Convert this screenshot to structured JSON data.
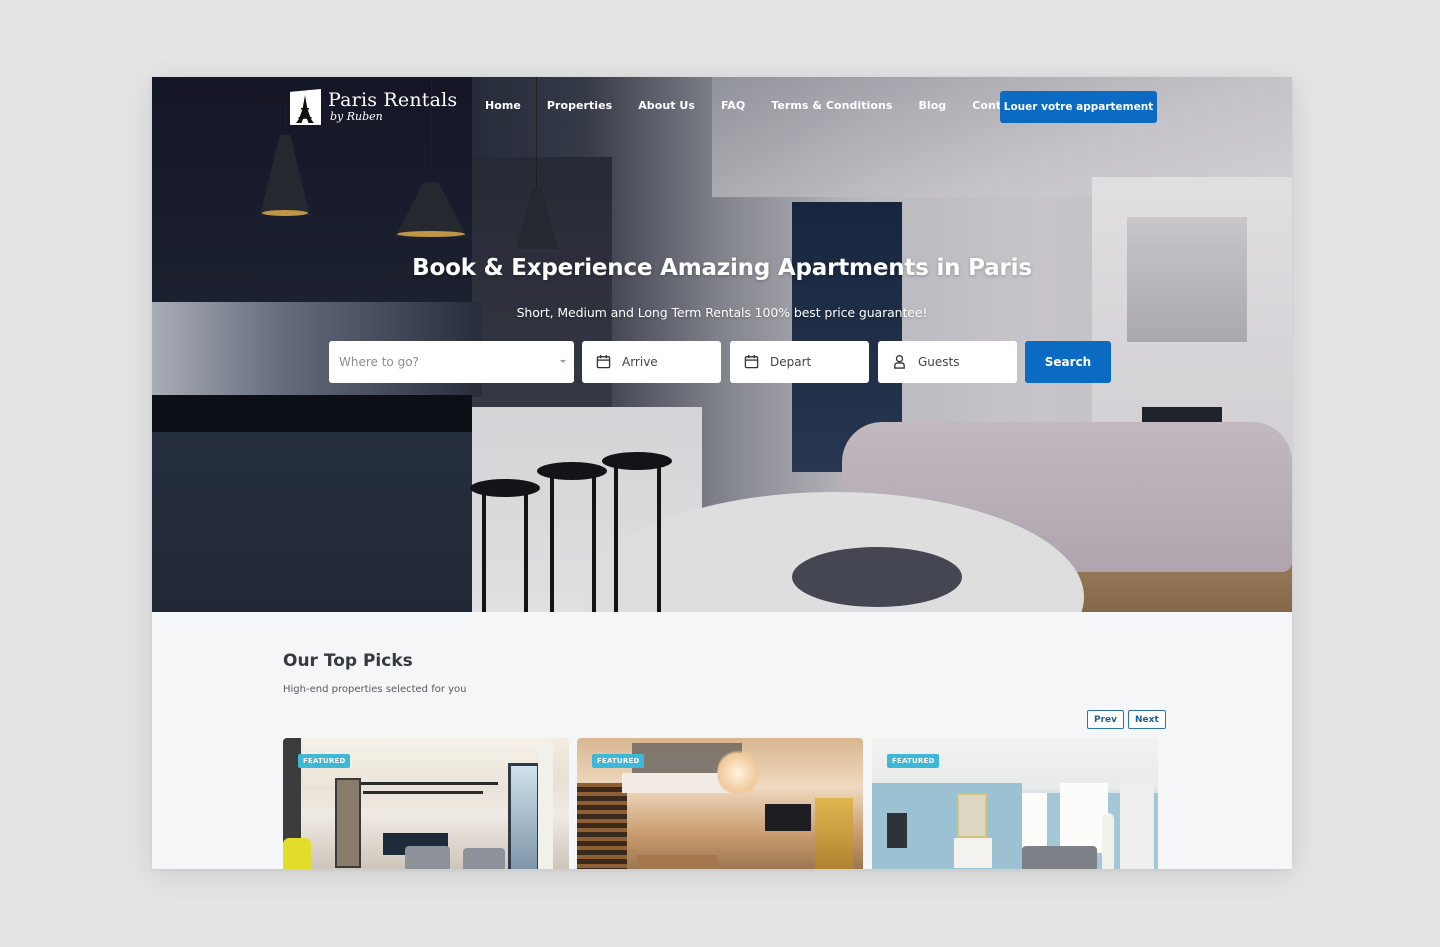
{
  "brand": {
    "title": "Paris Rentals",
    "subtitle": "by Ruben",
    "primary_color": "#0b6bc3",
    "badge_color": "#3fb7d6"
  },
  "nav": {
    "links": [
      {
        "label": "Home"
      },
      {
        "label": "Properties"
      },
      {
        "label": "About Us"
      },
      {
        "label": "FAQ"
      },
      {
        "label": "Terms & Conditions"
      },
      {
        "label": "Blog"
      },
      {
        "label": "Contact us"
      }
    ],
    "cta_label": "Louer votre appartement"
  },
  "hero": {
    "title": "Book & Experience Amazing Apartments in Paris",
    "subtitle": "Short, Medium and Long Term Rentals 100% best price guarantee!"
  },
  "search": {
    "where_placeholder": "Where to go?",
    "arrive_label": "Arrive",
    "depart_label": "Depart",
    "guests_label": "Guests",
    "button_label": "Search",
    "icons": {
      "arrive": "calendar-icon",
      "depart": "calendar-icon",
      "guests": "user-icon",
      "where": "chevron-down-icon"
    }
  },
  "top_picks": {
    "title": "Our Top Picks",
    "subtitle": "High-end properties selected for you",
    "prev_label": "Prev",
    "next_label": "Next",
    "cards": [
      {
        "badge": "FEATURED",
        "scene": "Bright open-plan living room with dark kitchen island and bar stools"
      },
      {
        "badge": "FEATURED",
        "scene": "Duplex loft with wooden staircase, mezzanine and large pendant light"
      },
      {
        "badge": "FEATURED",
        "scene": "Light blue Haussmann living room with fireplace and gray sofa"
      }
    ]
  }
}
